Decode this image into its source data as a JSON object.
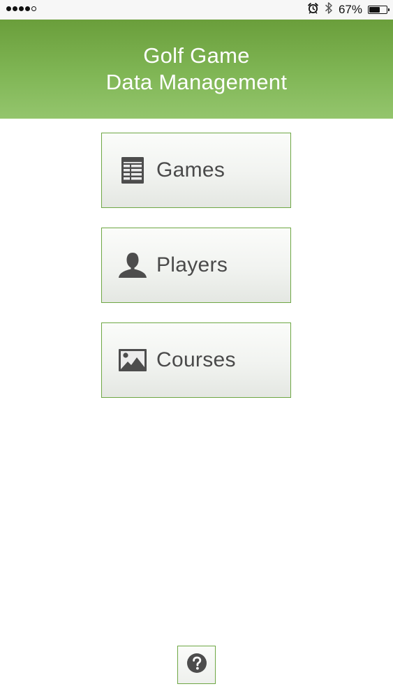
{
  "status_bar": {
    "signal_dots_filled": 4,
    "signal_dots_total": 5,
    "alarm_icon": "alarm-clock-icon",
    "bluetooth_icon": "bluetooth-icon",
    "battery_percent_text": "67%",
    "battery_level": 0.67
  },
  "header": {
    "title_line1": "Golf Game",
    "title_line2": "Data Management"
  },
  "menu": {
    "items": [
      {
        "label": "Games",
        "icon": "scorecard-table-icon"
      },
      {
        "label": "Players",
        "icon": "person-silhouette-icon"
      },
      {
        "label": "Courses",
        "icon": "picture-landscape-icon"
      }
    ]
  },
  "help": {
    "icon": "question-circle-icon"
  },
  "colors": {
    "header_green_top": "#6a9e3b",
    "header_green_bottom": "#94c56d",
    "button_border": "#6ea744",
    "button_text": "#4a4a4a",
    "icon_gray": "#4d4d4d"
  }
}
